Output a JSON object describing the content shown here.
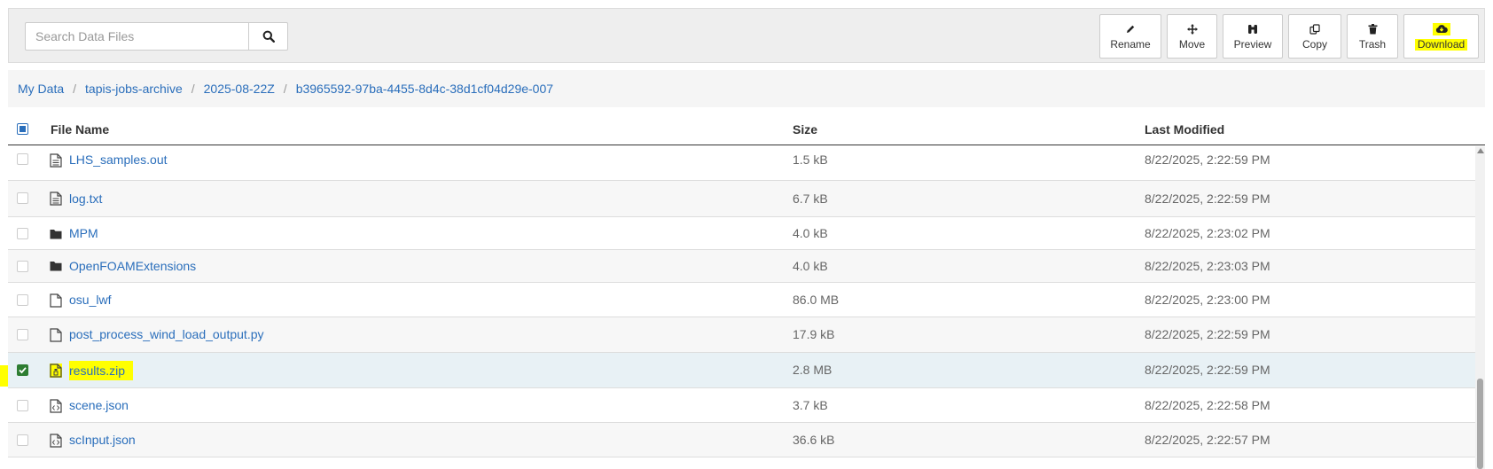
{
  "search": {
    "placeholder": "Search Data Files",
    "icon": "search-icon"
  },
  "toolbar": {
    "buttons": [
      {
        "label": "Rename",
        "icon": "pencil-icon"
      },
      {
        "label": "Move",
        "icon": "move-arrows-icon"
      },
      {
        "label": "Preview",
        "icon": "binoculars-icon"
      },
      {
        "label": "Copy",
        "icon": "copy-icon"
      },
      {
        "label": "Trash",
        "icon": "trash-icon"
      },
      {
        "label": "Download",
        "icon": "cloud-download-icon"
      }
    ]
  },
  "breadcrumb": {
    "items": [
      "My Data",
      "tapis-jobs-archive",
      "2025-08-22Z",
      "b3965592-97ba-4455-8d4c-38d1cf04d29e-007"
    ],
    "separator": "/"
  },
  "table": {
    "columns": {
      "name": "File Name",
      "size": "Size",
      "modified": "Last Modified"
    },
    "rows": [
      {
        "name": "LHS_samples.out",
        "size": "1.5 kB",
        "modified": "8/22/2025, 2:22:59 PM",
        "icon": "text-file-icon",
        "selected": false
      },
      {
        "name": "log.txt",
        "size": "6.7 kB",
        "modified": "8/22/2025, 2:22:59 PM",
        "icon": "text-file-icon",
        "selected": false
      },
      {
        "name": "MPM",
        "size": "4.0 kB",
        "modified": "8/22/2025, 2:23:02 PM",
        "icon": "folder-icon",
        "selected": false
      },
      {
        "name": "OpenFOAMExtensions",
        "size": "4.0 kB",
        "modified": "8/22/2025, 2:23:03 PM",
        "icon": "folder-icon",
        "selected": false
      },
      {
        "name": "osu_lwf",
        "size": "86.0 MB",
        "modified": "8/22/2025, 2:23:00 PM",
        "icon": "file-icon",
        "selected": false
      },
      {
        "name": "post_process_wind_load_output.py",
        "size": "17.9 kB",
        "modified": "8/22/2025, 2:22:59 PM",
        "icon": "file-icon",
        "selected": false
      },
      {
        "name": "results.zip",
        "size": "2.8 MB",
        "modified": "8/22/2025, 2:22:59 PM",
        "icon": "zip-file-icon",
        "selected": true
      },
      {
        "name": "scene.json",
        "size": "3.7 kB",
        "modified": "8/22/2025, 2:22:58 PM",
        "icon": "code-file-icon",
        "selected": false
      },
      {
        "name": "scInput.json",
        "size": "36.6 kB",
        "modified": "8/22/2025, 2:22:57 PM",
        "icon": "code-file-icon",
        "selected": false
      }
    ]
  },
  "colors": {
    "link": "#2a6ebb",
    "highlight": "#ffff00",
    "checked": "#2e7d32",
    "selected_row": "#e8f1f5"
  }
}
